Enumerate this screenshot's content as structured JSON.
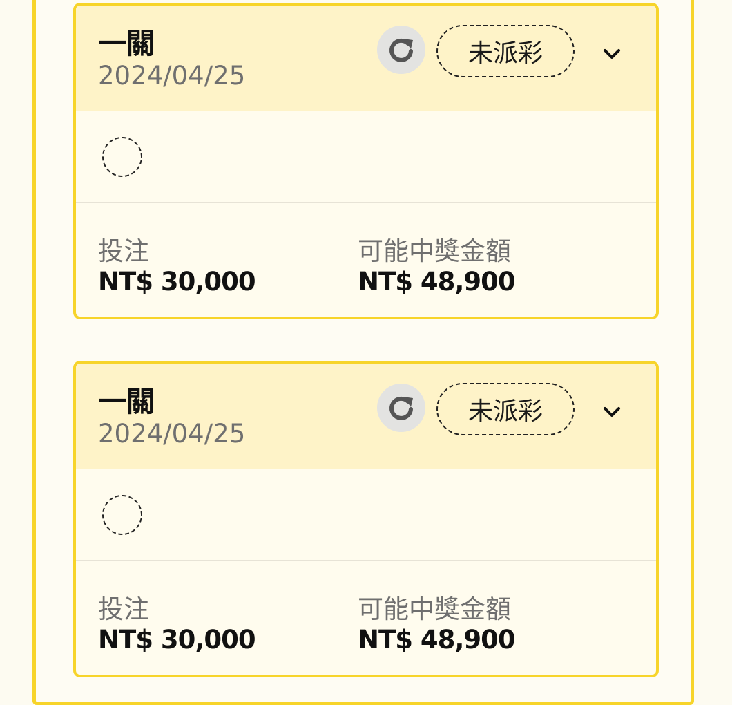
{
  "bets": [
    {
      "bet_type": "一關",
      "date": "2024/04/25",
      "status": "未派彩",
      "stake_label": "投注",
      "stake_value": "NT$ 30,000",
      "payout_label": "可能中獎金額",
      "payout_value": "NT$ 48,900"
    },
    {
      "bet_type": "一關",
      "date": "2024/04/25",
      "status": "未派彩",
      "stake_label": "投注",
      "stake_value": "NT$ 30,000",
      "payout_label": "可能中獎金額",
      "payout_value": "NT$ 48,900"
    }
  ],
  "icons": {
    "refresh": "refresh-icon",
    "expand": "chevron-down-icon",
    "pending_selection": "dashed-circle-icon"
  },
  "colors": {
    "accent_border": "#f7d42a",
    "header_bg": "#fef3c8",
    "card_bg": "#fffcee"
  }
}
